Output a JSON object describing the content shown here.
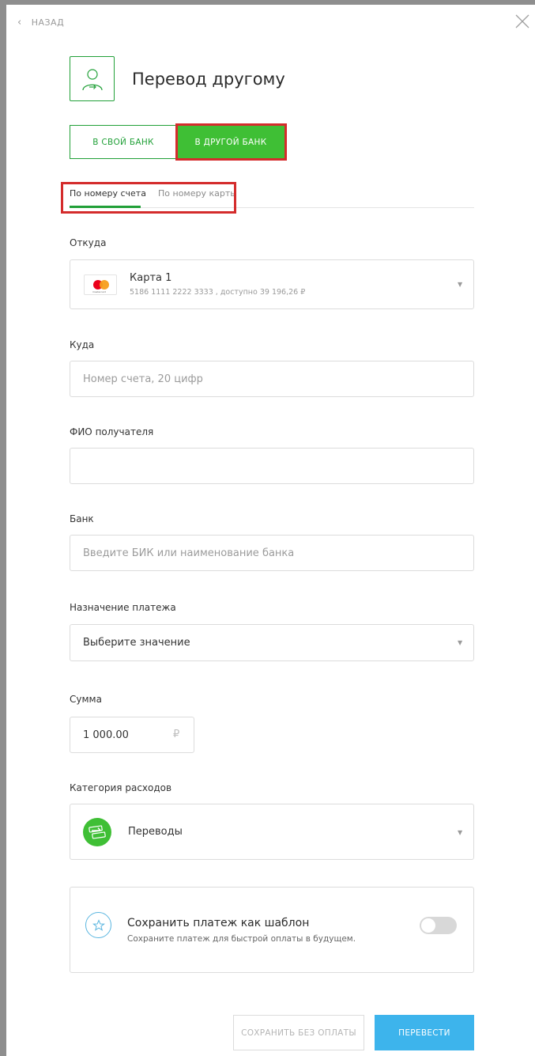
{
  "nav": {
    "back_label": "НАЗАД"
  },
  "header": {
    "title": "Перевод другому"
  },
  "bank_switch": {
    "own_bank": "В СВОЙ БАНК",
    "other_bank": "В ДРУГОЙ БАНК",
    "selected": "other_bank"
  },
  "tabs": {
    "by_account": "По номеру счета",
    "by_card": "По номеру карты",
    "selected": "by_account"
  },
  "from": {
    "label": "Откуда",
    "card_name": "Карта 1",
    "card_details": "5186 1111 2222 3333 , доступно 39 196,26 ₽",
    "card_brand_icon": "mastercard-icon"
  },
  "to": {
    "label": "Куда",
    "placeholder": "Номер счета, 20 цифр"
  },
  "recipient": {
    "label": "ФИО получателя",
    "value": ""
  },
  "bank": {
    "label": "Банк",
    "placeholder": "Введите БИК или наименование банка"
  },
  "purpose": {
    "label": "Назначение платежа",
    "placeholder": "Выберите значение"
  },
  "amount": {
    "label": "Сумма",
    "value": "1 000.00",
    "currency": "₽"
  },
  "category": {
    "label": "Категория расходов",
    "value": "Переводы",
    "icon": "transfer-arrows-icon"
  },
  "template": {
    "title": "Сохранить платеж как шаблон",
    "subtitle": "Сохраните платеж для быстрой оплаты в будущем.",
    "enabled": false
  },
  "actions": {
    "save_without_pay": "СОХРАНИТЬ БЕЗ ОПЛАТЫ",
    "transfer": "ПЕРЕВЕСТИ"
  },
  "colors": {
    "accent_green": "#3fbf35",
    "brand_green": "#21a038",
    "primary_blue": "#3db4ec",
    "highlight_red": "#d42c2c"
  }
}
